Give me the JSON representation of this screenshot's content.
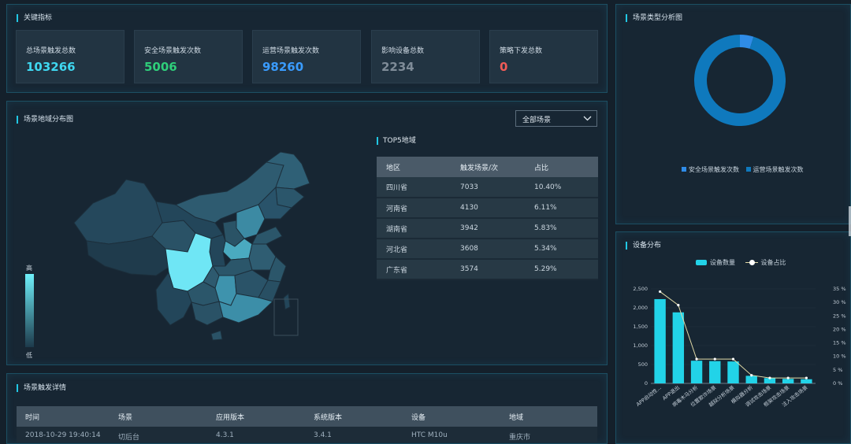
{
  "key_metrics": {
    "title": "关键指标",
    "cards": [
      {
        "label": "总场景触发总数",
        "value": "103266",
        "color": "#3fd7f0"
      },
      {
        "label": "安全场景触发次数",
        "value": "5006",
        "color": "#2fce7a"
      },
      {
        "label": "运营场景触发次数",
        "value": "98260",
        "color": "#3a9cff"
      },
      {
        "label": "影响设备总数",
        "value": "2234",
        "color": "#7f8c98"
      },
      {
        "label": "策略下发总数",
        "value": "0",
        "color": "#f05b57"
      }
    ]
  },
  "scene_type": {
    "title": "场景类型分析图",
    "legend": [
      "安全场景触发次数",
      "运营场景触发次数"
    ],
    "slices": [
      {
        "name": "安全场景触发次数",
        "value": 5006,
        "color": "#2f8ce8"
      },
      {
        "name": "运营场景触发次数",
        "value": 98260,
        "color": "#0f79bd"
      }
    ]
  },
  "region_map": {
    "title": "场景地域分布图",
    "filter_value": "全部场景",
    "scale_high": "高",
    "scale_low": "低"
  },
  "top5": {
    "title": "TOP5地域",
    "headers": [
      "地区",
      "触发场景/次",
      "占比"
    ],
    "rows": [
      [
        "四川省",
        "7033",
        "10.40%"
      ],
      [
        "河南省",
        "4130",
        "6.11%"
      ],
      [
        "湖南省",
        "3942",
        "5.83%"
      ],
      [
        "河北省",
        "3608",
        "5.34%"
      ],
      [
        "广东省",
        "3574",
        "5.29%"
      ]
    ]
  },
  "details": {
    "title": "场景触发详情",
    "headers": [
      "时间",
      "场景",
      "应用版本",
      "系统版本",
      "设备",
      "地域"
    ],
    "rows": [
      [
        "2018-10-29 19:40:14",
        "切后台",
        "4.3.1",
        "3.4.1",
        "HTC M10u",
        "重庆市"
      ]
    ]
  },
  "device": {
    "title": "设备分布",
    "legend_bar": "设备数量",
    "legend_line": "设备占比"
  },
  "chart_data": {
    "type": "bar",
    "categories": [
      "APP启动性...",
      "APP退出",
      "病毒木马分析",
      "位置欺诈场景",
      "越狱分析场景",
      "模拟器分析",
      "调试攻击场景",
      "框架攻击场景",
      "注入攻击场景"
    ],
    "series": [
      {
        "name": "设备数量",
        "type": "bar",
        "values": [
          2230,
          1880,
          600,
          590,
          580,
          200,
          140,
          120,
          110
        ],
        "color": "#22d3e8"
      },
      {
        "name": "设备占比",
        "type": "line",
        "values": [
          34,
          29,
          9,
          9,
          9,
          3,
          2,
          2,
          2
        ],
        "color": "#e0d9a6"
      }
    ],
    "ylim": [
      0,
      2500
    ],
    "yticks": [
      "0",
      "500",
      "1,000",
      "1,500",
      "2,000",
      "2,500"
    ],
    "y2lim": [
      0,
      35
    ],
    "y2ticks": [
      "0 %",
      "5 %",
      "10 %",
      "15 %",
      "20 %",
      "25 %",
      "30 %",
      "35 %"
    ]
  }
}
